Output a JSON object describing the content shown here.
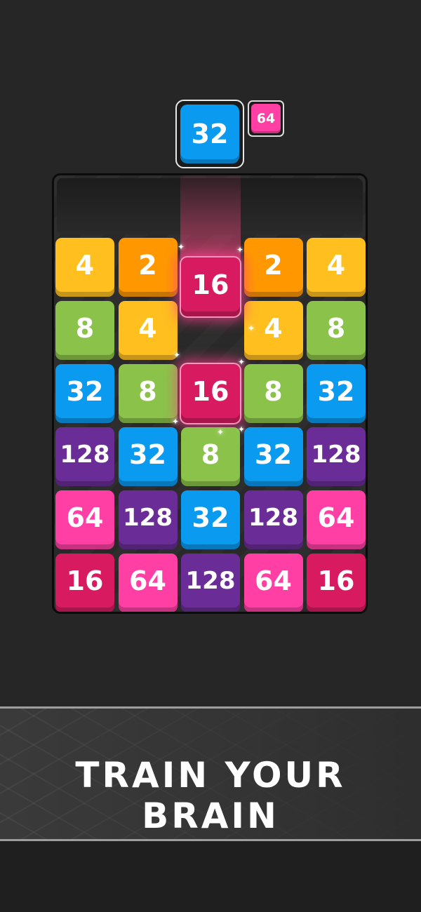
{
  "colors": {
    "background": "#262626",
    "value_2": "#ff9800",
    "value_4": "#ffbf1f",
    "value_8": "#8bc34a",
    "value_16": "#d81b60",
    "value_32": "#0a9af0",
    "value_64": "#ff3fa4",
    "value_128": "#6a2d97"
  },
  "current_tile": {
    "value": "32",
    "color": "#0a9af0"
  },
  "next_tile": {
    "value": "64",
    "color": "#ff3fa4"
  },
  "board": {
    "rows": [
      [
        {
          "value": "4",
          "color": "#ffbf1f"
        },
        {
          "value": "2",
          "color": "#ff9800"
        },
        null,
        {
          "value": "2",
          "color": "#ff9800"
        },
        {
          "value": "4",
          "color": "#ffbf1f"
        }
      ],
      [
        {
          "value": "8",
          "color": "#8bc34a"
        },
        {
          "value": "4",
          "color": "#ffbf1f"
        },
        null,
        {
          "value": "4",
          "color": "#ffbf1f"
        },
        {
          "value": "8",
          "color": "#8bc34a"
        }
      ],
      [
        {
          "value": "32",
          "color": "#0a9af0"
        },
        {
          "value": "8",
          "color": "#8bc34a"
        },
        {
          "value": "16",
          "color": "#d81b60",
          "highlight": true
        },
        {
          "value": "8",
          "color": "#8bc34a"
        },
        {
          "value": "32",
          "color": "#0a9af0"
        }
      ],
      [
        {
          "value": "128",
          "color": "#6a2d97"
        },
        {
          "value": "32",
          "color": "#0a9af0"
        },
        {
          "value": "8",
          "color": "#8bc34a"
        },
        {
          "value": "32",
          "color": "#0a9af0"
        },
        {
          "value": "128",
          "color": "#6a2d97"
        }
      ],
      [
        {
          "value": "64",
          "color": "#ff3fa4"
        },
        {
          "value": "128",
          "color": "#6a2d97"
        },
        {
          "value": "32",
          "color": "#0a9af0"
        },
        {
          "value": "128",
          "color": "#6a2d97"
        },
        {
          "value": "64",
          "color": "#ff3fa4"
        }
      ],
      [
        {
          "value": "16",
          "color": "#d81b60"
        },
        {
          "value": "64",
          "color": "#ff3fa4"
        },
        {
          "value": "128",
          "color": "#6a2d97"
        },
        {
          "value": "64",
          "color": "#ff3fa4"
        },
        {
          "value": "16",
          "color": "#d81b60"
        }
      ]
    ],
    "dropping_tile": {
      "value": "16",
      "color": "#d81b60",
      "column": 3
    }
  },
  "banner": {
    "text": "TRAIN YOUR BRAIN"
  }
}
